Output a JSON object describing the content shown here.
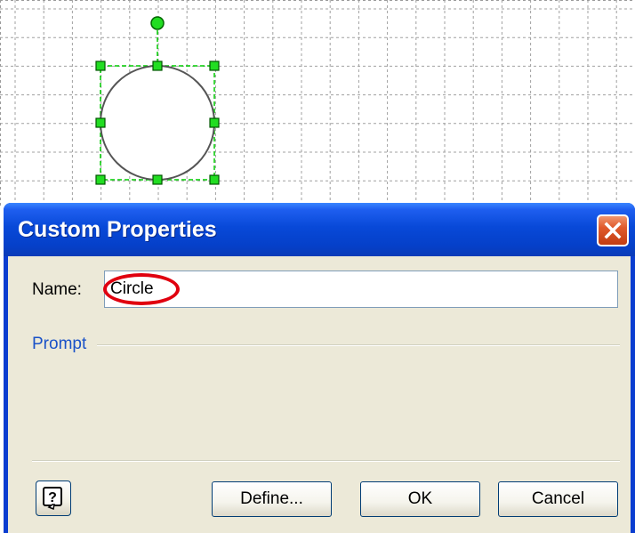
{
  "dialog": {
    "title": "Custom Properties",
    "name_label": "Name:",
    "name_value": "Circle",
    "prompt_label": "Prompt",
    "buttons": {
      "define": "Define...",
      "ok": "OK",
      "cancel": "Cancel"
    },
    "icons": {
      "close": "close-icon",
      "help": "help-icon"
    }
  },
  "canvas": {
    "shape": "circle",
    "selection_color": "#00cc00",
    "highlight_color": "#e0000f"
  }
}
